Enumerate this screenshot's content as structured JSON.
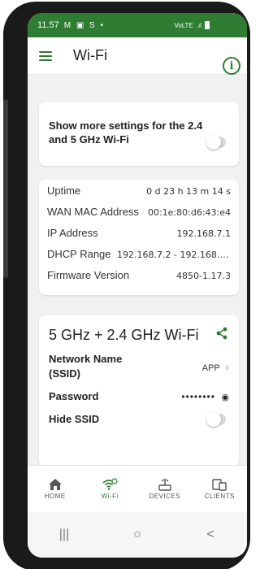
{
  "status_bar": {
    "time": "11.57",
    "icons": "M ▣ S •",
    "network": "VoLTE",
    "signal": ".ıl"
  },
  "app_bar": {
    "title": "Wi-Fi",
    "info_glyph": "i"
  },
  "settings_card": {
    "text": "Show more settings for the 2.4 and 5 GHz Wi-Fi",
    "toggle_on": false
  },
  "info_card": {
    "rows": [
      {
        "label": "Uptime",
        "value": "0 d 23 h 13 m 14 s"
      },
      {
        "label": "WAN MAC Address",
        "value": "00:1e:80:d6:43:e4"
      },
      {
        "label": "IP Address",
        "value": "192.168.7.1"
      },
      {
        "label": "DHCP Range",
        "value": "192.168.7.2 - 192.168.7...."
      },
      {
        "label": "Firmware Version",
        "value": "4850-1.17.3"
      }
    ]
  },
  "wifi_card": {
    "title": "5 GHz + 2.4 GHz Wi-Fi",
    "network_name_label": "Network Name (SSID)",
    "network_name_value": "APP",
    "password_label": "Password",
    "password_value": "••••••••",
    "hide_ssid_label": "Hide SSID",
    "hide_ssid_on": false
  },
  "bottom_nav": {
    "items": [
      {
        "label": "HOME",
        "icon": "home-icon",
        "active": false
      },
      {
        "label": "Wi-Fi",
        "icon": "wifi-icon",
        "active": true
      },
      {
        "label": "DEVICES",
        "icon": "router-icon",
        "active": false
      },
      {
        "label": "CLIENTS",
        "icon": "clients-icon",
        "active": false
      }
    ]
  },
  "system_nav": {
    "recents": "|||",
    "home": "○",
    "back": "<"
  },
  "colors": {
    "accent": "#2f7d33",
    "background": "#f0f1f0",
    "card": "#ffffff"
  }
}
